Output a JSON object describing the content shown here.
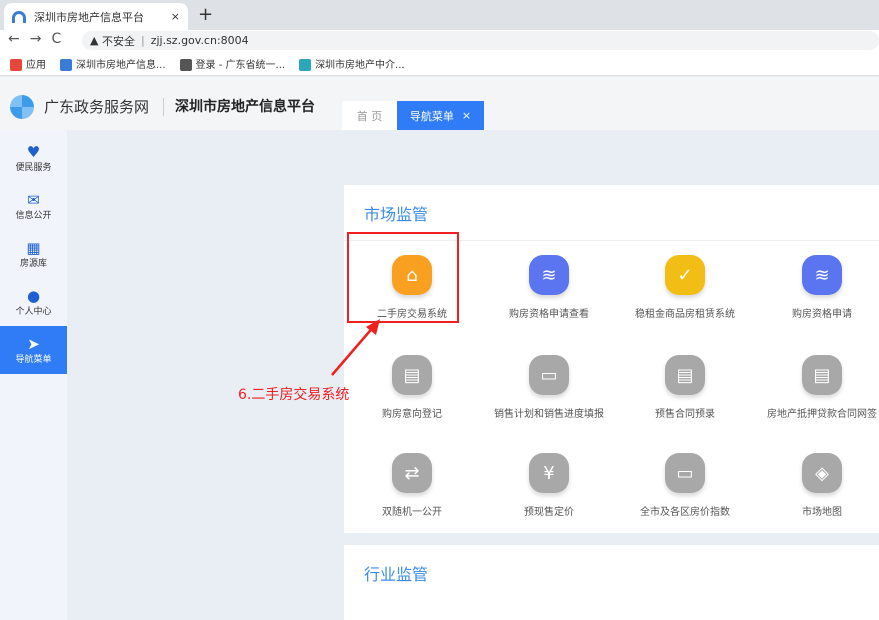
{
  "browser": {
    "tab_title": "深圳市房地产信息平台",
    "new_tab": "+",
    "close": "×",
    "nav": "←→C",
    "security": "不安全",
    "url": "zjj.sz.gov.cn:8004",
    "bookmarks": [
      {
        "label": "应用",
        "color": "#e8453c"
      },
      {
        "label": "深圳市房地产信息...",
        "color": "#3a7bd5"
      },
      {
        "label": "登录 - 广东省统一...",
        "color": "#555555"
      },
      {
        "label": "深圳市房地产中介...",
        "color": "#2aa6b8"
      }
    ]
  },
  "header": {
    "gov": "广东政务服务网",
    "platform": "深圳市房地产信息平台",
    "tabs": [
      {
        "label": "首 页"
      },
      {
        "label": "导航菜单",
        "close": "×"
      }
    ]
  },
  "sidebar": [
    {
      "label": "便民服务",
      "icon": "♥"
    },
    {
      "label": "信息公开",
      "icon": "✉"
    },
    {
      "label": "房源库",
      "icon": "▦"
    },
    {
      "label": "个人中心",
      "icon": "●"
    },
    {
      "label": "导航菜单",
      "icon": "➤"
    }
  ],
  "sections": [
    {
      "title": "市场监管",
      "items": [
        {
          "label": "二手房交易系统",
          "icon": "⌂",
          "color": "#f9a020"
        },
        {
          "label": "购房资格申请查看",
          "icon": "≋",
          "color": "#5b74f0"
        },
        {
          "label": "稳租金商品房租赁系统",
          "icon": "✓",
          "color": "#f2bd14"
        },
        {
          "label": "购房资格申请",
          "icon": "≋",
          "color": "#5b74f0"
        },
        {
          "label": "购房意向登记",
          "icon": "▤",
          "color": "#a8a8a8"
        },
        {
          "label": "销售计划和销售进度填报",
          "icon": "▭",
          "color": "#a8a8a8"
        },
        {
          "label": "预售合同预录",
          "icon": "▤",
          "color": "#a8a8a8"
        },
        {
          "label": "房地产抵押贷款合同网签",
          "icon": "▤",
          "color": "#a8a8a8"
        },
        {
          "label": "双随机一公开",
          "icon": "⇄",
          "color": "#a8a8a8"
        },
        {
          "label": "预现售定价",
          "icon": "¥",
          "color": "#a8a8a8"
        },
        {
          "label": "全市及各区房价指数",
          "icon": "▭",
          "color": "#a8a8a8"
        },
        {
          "label": "市场地图",
          "icon": "◈",
          "color": "#a8a8a8"
        }
      ]
    },
    {
      "title": "行业监管"
    }
  ],
  "annotation": "6.二手房交易系统"
}
